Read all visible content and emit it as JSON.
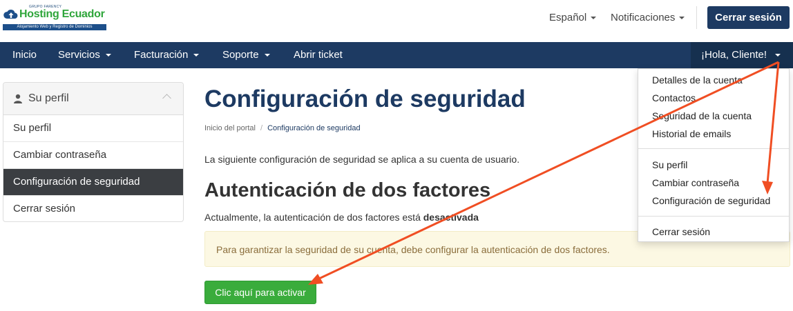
{
  "logo": {
    "small": "GRUPO FARENCY",
    "main": "Hosting Ecuador",
    "tagline": "Alojamiento Web y Registro de Dominios"
  },
  "topbar": {
    "language": "Español",
    "notifications": "Notificaciones",
    "logout": "Cerrar sesión"
  },
  "navbar": {
    "items": [
      {
        "label": "Inicio"
      },
      {
        "label": "Servicios"
      },
      {
        "label": "Facturación"
      },
      {
        "label": "Soporte"
      },
      {
        "label": "Abrir ticket"
      }
    ],
    "account": "¡Hola, Cliente!"
  },
  "sidebar": {
    "title": "Su perfil",
    "items": [
      {
        "label": "Su perfil"
      },
      {
        "label": "Cambiar contraseña"
      },
      {
        "label": "Configuración de seguridad"
      },
      {
        "label": "Cerrar sesión"
      }
    ]
  },
  "main": {
    "title": "Configuración de seguridad",
    "breadcrumb": {
      "home": "Inicio del portal",
      "separator": "/",
      "current": "Configuración de seguridad"
    },
    "intro": "La siguiente configuración de seguridad se aplica a su cuenta de usuario.",
    "section_title": "Autenticación de dos factores",
    "status_prefix": "Actualmente, la autenticación de dos factores está",
    "status_value": "desactivada",
    "alert": "Para garantizar la seguridad de su cuenta, debe configurar la autenticación de dos factores.",
    "activate_button": "Clic aquí para activar"
  },
  "dropdown": {
    "group1": [
      {
        "label": "Detalles de la cuenta"
      },
      {
        "label": "Contactos"
      },
      {
        "label": "Seguridad de la cuenta"
      },
      {
        "label": "Historial de emails"
      }
    ],
    "group2": [
      {
        "label": "Su perfil"
      },
      {
        "label": "Cambiar contraseña"
      },
      {
        "label": "Configuración de seguridad"
      }
    ],
    "group3": [
      {
        "label": "Cerrar sesión"
      }
    ]
  },
  "colors": {
    "brand_navy": "#1d3a62",
    "brand_green": "#2fa63b",
    "annotation_arrow": "#f04e23",
    "alert_bg": "#fcf8e3",
    "success": "#3aac3c"
  },
  "icons": {
    "sidebar_header": "user-icon",
    "logo": "cloud-upload-icon"
  }
}
